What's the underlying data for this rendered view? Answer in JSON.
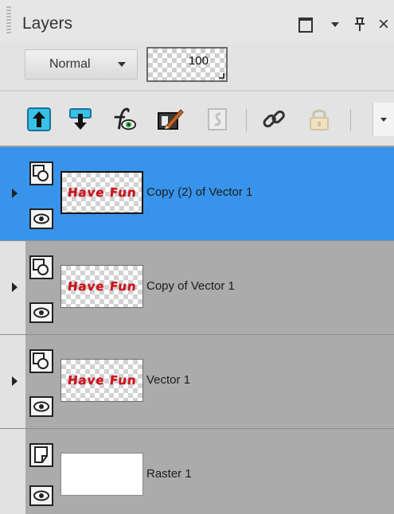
{
  "palette": {
    "title": "Layers",
    "window_controls": {
      "restore_icon": "window-restore-icon",
      "menu_icon": "dropdown-arrow-icon",
      "pin": "ᵽ",
      "pin_icon": "pin-icon",
      "close": "×",
      "close_icon": "close-icon"
    }
  },
  "blend_mode": {
    "selected": "Normal"
  },
  "opacity": {
    "value": "100"
  },
  "toolbar": {
    "items": [
      {
        "name": "move-layer-up-icon"
      },
      {
        "name": "move-layer-down-icon"
      },
      {
        "name": "layer-styles-fx-icon"
      },
      {
        "name": "edit-mask-icon"
      },
      {
        "name": "group-layers-icon",
        "enabled": false
      },
      {
        "name": "link-layers-icon"
      },
      {
        "name": "lock-layer-icon",
        "enabled": false
      },
      {
        "name": "toolbar-overflow-icon"
      }
    ]
  },
  "layers": [
    {
      "name": "Copy (2) of Vector 1",
      "thumbnail_text": "Have Fun",
      "type_icon": "vector-layer-icon",
      "visible": true,
      "selected": true,
      "expandable": true
    },
    {
      "name": "Copy of Vector 1",
      "thumbnail_text": "Have Fun",
      "type_icon": "vector-layer-icon",
      "visible": true,
      "selected": false,
      "expandable": true
    },
    {
      "name": "Vector 1",
      "thumbnail_text": "Have Fun",
      "type_icon": "vector-layer-icon",
      "visible": true,
      "selected": false,
      "expandable": true
    },
    {
      "name": "Raster 1",
      "thumbnail_text": "",
      "type_icon": "raster-layer-icon",
      "visible": true,
      "selected": false,
      "expandable": false
    }
  ],
  "colors": {
    "selection": "#3794ea",
    "row_background": "#ababab",
    "thumbnail_text": "#d1121c"
  }
}
